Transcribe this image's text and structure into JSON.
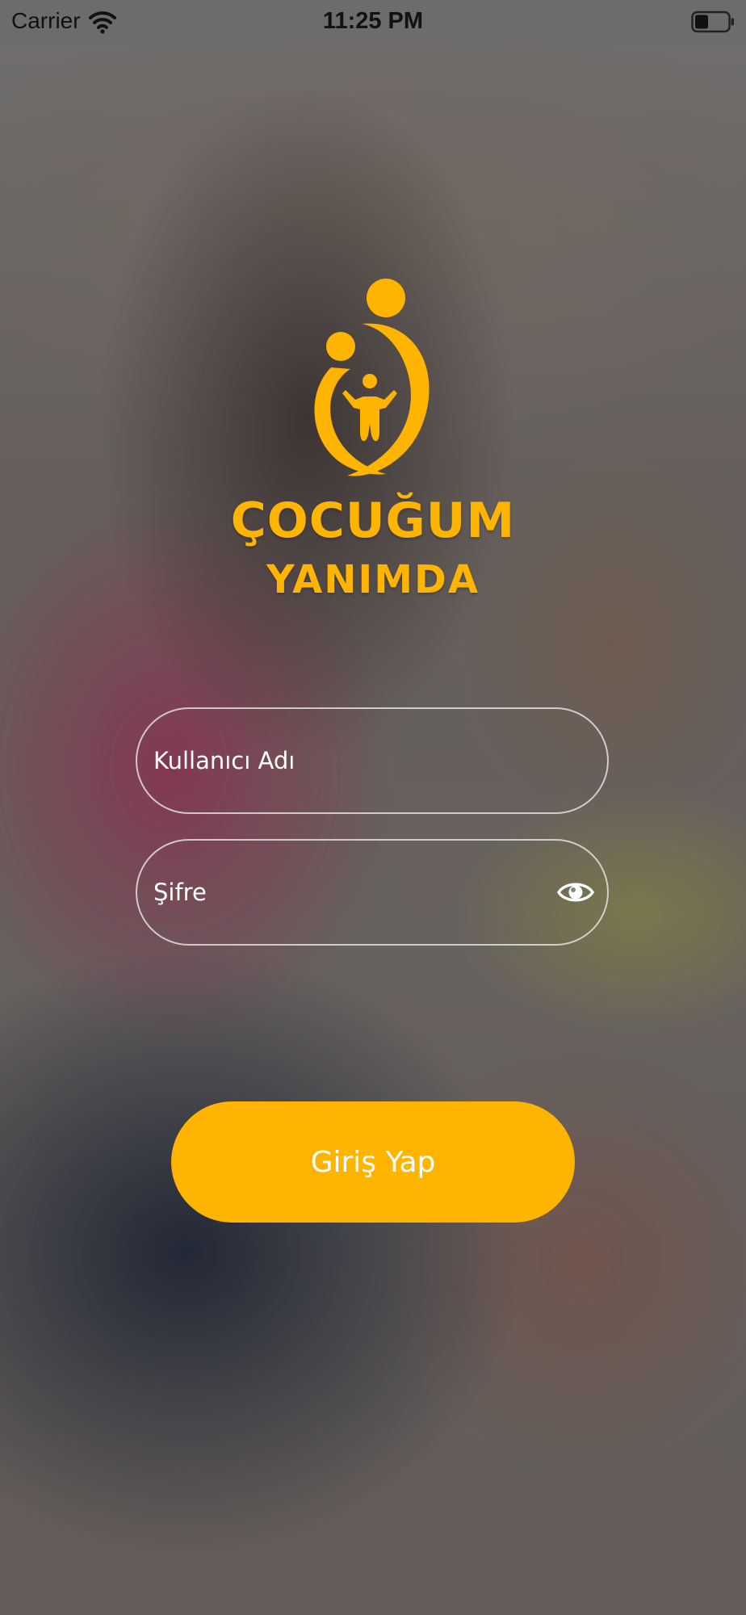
{
  "status_bar": {
    "carrier": "Carrier",
    "time": "11:25 PM",
    "wifi_icon": "wifi-icon",
    "battery_icon": "battery-icon"
  },
  "brand": {
    "logo_icon": "parent-child-logo-icon",
    "line1": "ÇOCUĞUM",
    "line2": "YANIMDA",
    "color": "#ffb400"
  },
  "login_form": {
    "username_placeholder": "Kullanıcı Adı",
    "username_value": "",
    "password_placeholder": "Şifre",
    "password_value": "",
    "show_password_icon": "eye-icon",
    "submit_label": "Giriş Yap",
    "button_color": "#ffb400"
  }
}
